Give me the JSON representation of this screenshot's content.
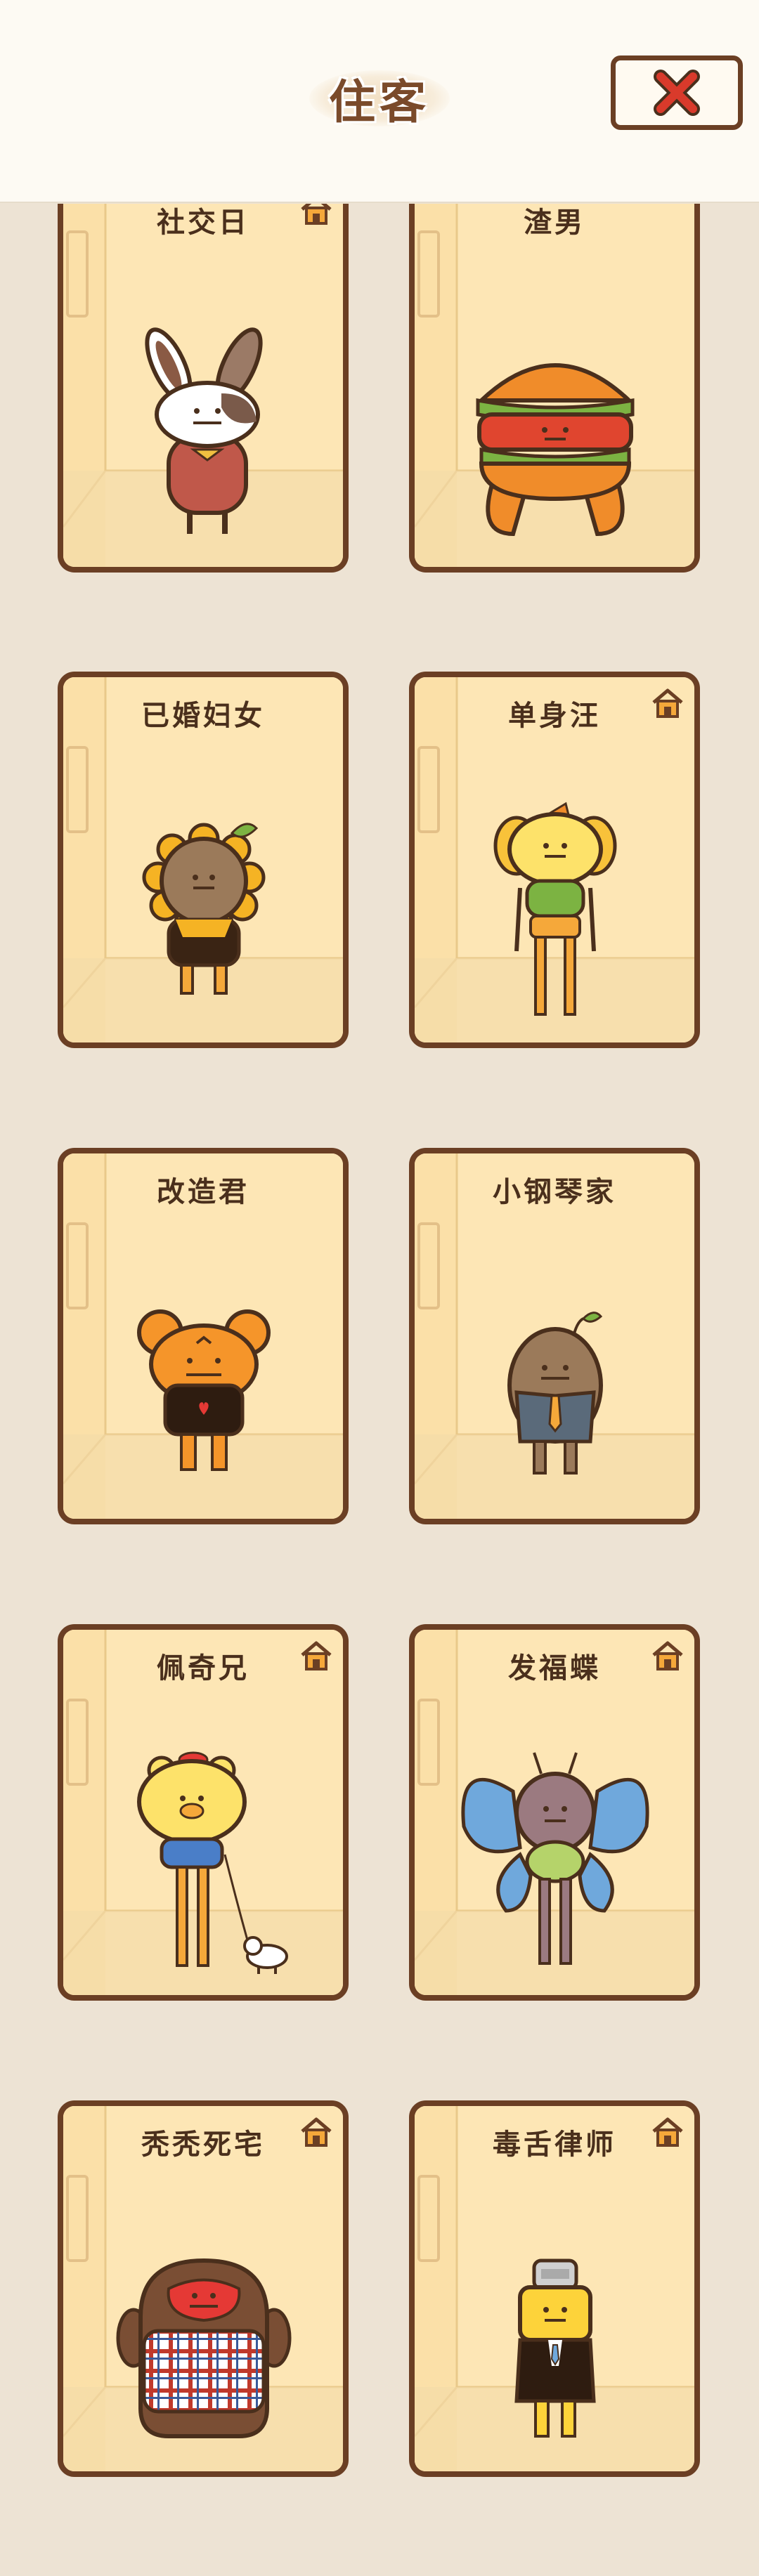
{
  "header": {
    "title": "住客",
    "close_icon": "close-x-icon"
  },
  "colors": {
    "background": "#ede3d4",
    "header_bg": "#fdfaf3",
    "card_border": "#6b3f24",
    "card_bg": "#fde6b5",
    "close_x": "#d93a2b"
  },
  "residents": [
    {
      "name": "社交日",
      "has_home_icon": true,
      "character": "bunny"
    },
    {
      "name": "渣男",
      "has_home_icon": false,
      "character": "burger"
    },
    {
      "name": "已婚妇女",
      "has_home_icon": false,
      "character": "sunflower"
    },
    {
      "name": "单身汪",
      "has_home_icon": true,
      "character": "dog"
    },
    {
      "name": "改造君",
      "has_home_icon": false,
      "character": "bear"
    },
    {
      "name": "小钢琴家",
      "has_home_icon": false,
      "character": "sprout"
    },
    {
      "name": "佩奇兄",
      "has_home_icon": true,
      "character": "pig-walker"
    },
    {
      "name": "发福蝶",
      "has_home_icon": true,
      "character": "butterfly"
    },
    {
      "name": "秃秃死宅",
      "has_home_icon": true,
      "character": "plaid-blob"
    },
    {
      "name": "毒舌律师",
      "has_home_icon": true,
      "character": "lawyer"
    }
  ]
}
